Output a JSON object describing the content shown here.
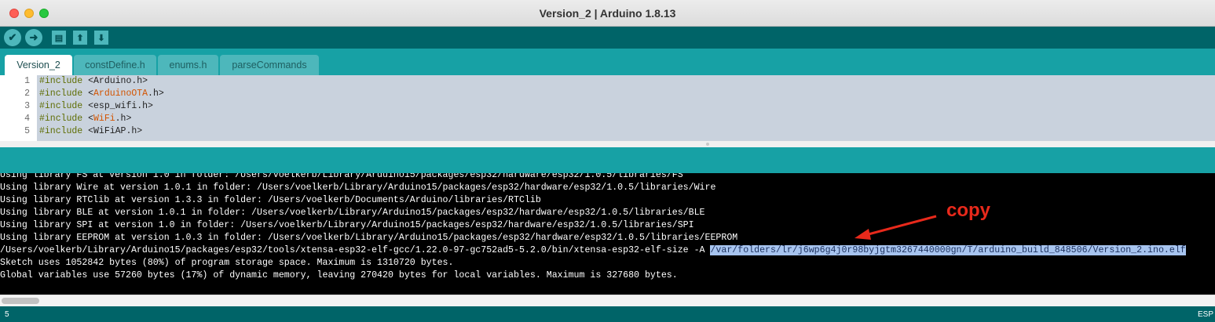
{
  "window": {
    "title": "Version_2 | Arduino 1.8.13"
  },
  "toolbar": {
    "verify_icon": "checkmark-icon",
    "upload_icon": "arrow-right-icon",
    "new_icon": "new-file-icon",
    "open_icon": "arrow-up-icon",
    "save_icon": "arrow-down-icon"
  },
  "tabs": [
    {
      "label": "Version_2",
      "active": true
    },
    {
      "label": "constDefine.h",
      "active": false
    },
    {
      "label": "enums.h",
      "active": false
    },
    {
      "label": "parseCommands",
      "active": false
    }
  ],
  "editor": {
    "lines": [
      {
        "num": "1",
        "kw": "#include",
        "open": " <",
        "lib": "Arduino",
        "close": ".h>",
        "lib_highlight": false
      },
      {
        "num": "2",
        "kw": "#include",
        "open": " <",
        "lib": "ArduinoOTA",
        "close": ".h>",
        "lib_highlight": true
      },
      {
        "num": "3",
        "kw": "#include",
        "open": " <",
        "lib": "esp_wifi",
        "close": ".h>",
        "lib_highlight": false
      },
      {
        "num": "4",
        "kw": "#include",
        "open": " <",
        "lib": "WiFi",
        "close": ".h>",
        "lib_highlight": true
      },
      {
        "num": "5",
        "kw": "#include",
        "open": " <",
        "lib": "WiFiAP",
        "close": ".h>",
        "lib_highlight": false
      }
    ]
  },
  "console": {
    "lines": [
      "Using library FS at version 1.0 in folder: /Users/voelkerb/Library/Arduino15/packages/esp32/hardware/esp32/1.0.5/libraries/FS",
      "Using library Wire at version 1.0.1 in folder: /Users/voelkerb/Library/Arduino15/packages/esp32/hardware/esp32/1.0.5/libraries/Wire",
      "Using library RTClib at version 1.3.3 in folder: /Users/voelkerb/Documents/Arduino/libraries/RTClib",
      "Using library BLE at version 1.0.1 in folder: /Users/voelkerb/Library/Arduino15/packages/esp32/hardware/esp32/1.0.5/libraries/BLE",
      "Using library SPI at version 1.0 in folder: /Users/voelkerb/Library/Arduino15/packages/esp32/hardware/esp32/1.0.5/libraries/SPI",
      "Using library EEPROM at version 1.0.3 in folder: /Users/voelkerb/Library/Arduino15/packages/esp32/hardware/esp32/1.0.5/libraries/EEPROM"
    ],
    "size_cmd_prefix": "/Users/voelkerb/Library/Arduino15/packages/esp32/tools/xtensa-esp32-elf-gcc/1.22.0-97-gc752ad5-5.2.0/bin/xtensa-esp32-elf-size -A ",
    "size_cmd_selected": "/var/folders/lr/j6wp6g4j0r98byjgtm3267440000gn/T/arduino_build_848506/Version_2.ino.elf",
    "summary_lines": [
      "Sketch uses 1052842 bytes (80%) of program storage space. Maximum is 1310720 bytes.",
      "Global variables use 57260 bytes (17%) of dynamic memory, leaving 270420 bytes for local variables. Maximum is 327680 bytes."
    ]
  },
  "annotation": {
    "label": "copy",
    "color": "#e8291b"
  },
  "statusbar": {
    "line_number": "5",
    "right_text": "ESP"
  },
  "colors": {
    "teal": "#17a1a5",
    "dark_teal": "#006468",
    "keyword": "#5e6d03",
    "library": "#d35400"
  }
}
